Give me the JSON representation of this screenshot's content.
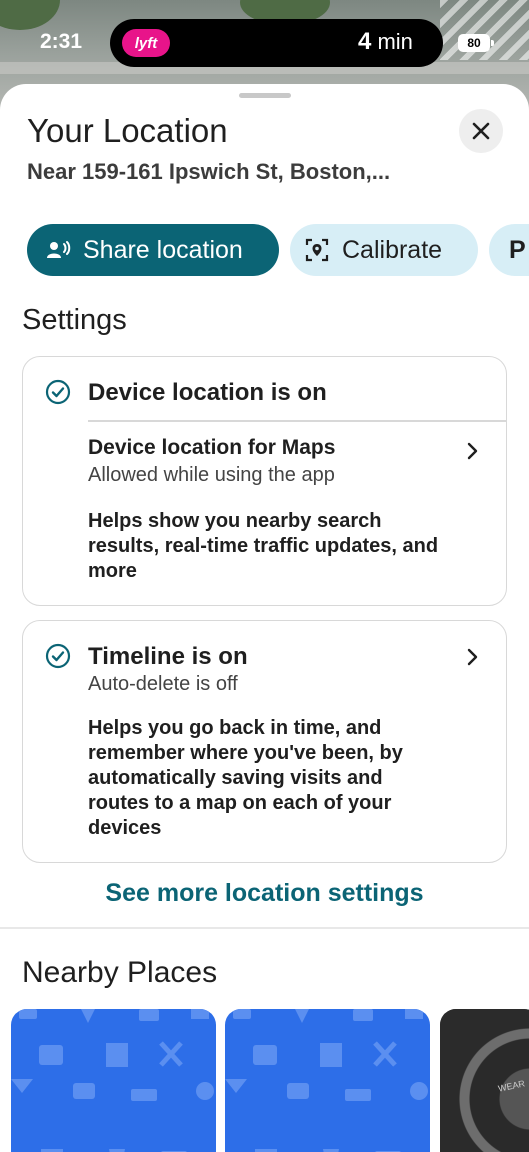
{
  "status_bar": {
    "time": "2:31",
    "lyft_label": "lyft",
    "eta_value": "4",
    "eta_unit": " min",
    "battery": "80"
  },
  "sheet": {
    "title": "Your Location",
    "address": "Near 159-161 Ipswich St, Boston,...",
    "chips": {
      "share": "Share location",
      "calibrate": "Calibrate",
      "more": "P"
    }
  },
  "settings": {
    "heading": "Settings",
    "device_card": {
      "title": "Device location is on",
      "row_title": "Device location for Maps",
      "row_sub": "Allowed while using the app",
      "description": "Helps show you nearby search results, real-time traffic updates, and more"
    },
    "timeline_card": {
      "title": "Timeline is on",
      "sub": "Auto-delete is off",
      "description": "Helps you go back in time, and remember where you've been, by automatically saving visits and routes to a map on each of your devices"
    },
    "see_more": "See more location settings"
  },
  "nearby": {
    "heading": "Nearby Places",
    "tire_text": "WEAR"
  },
  "colors": {
    "accent": "#0b6475",
    "chip_light": "#d7eef6",
    "place_blue": "#2d6ee8",
    "lyft_pink": "#e8148a"
  },
  "icons": [
    "share-location-icon",
    "calibrate-icon",
    "close-icon",
    "check-circle-icon",
    "chevron-right-icon"
  ]
}
